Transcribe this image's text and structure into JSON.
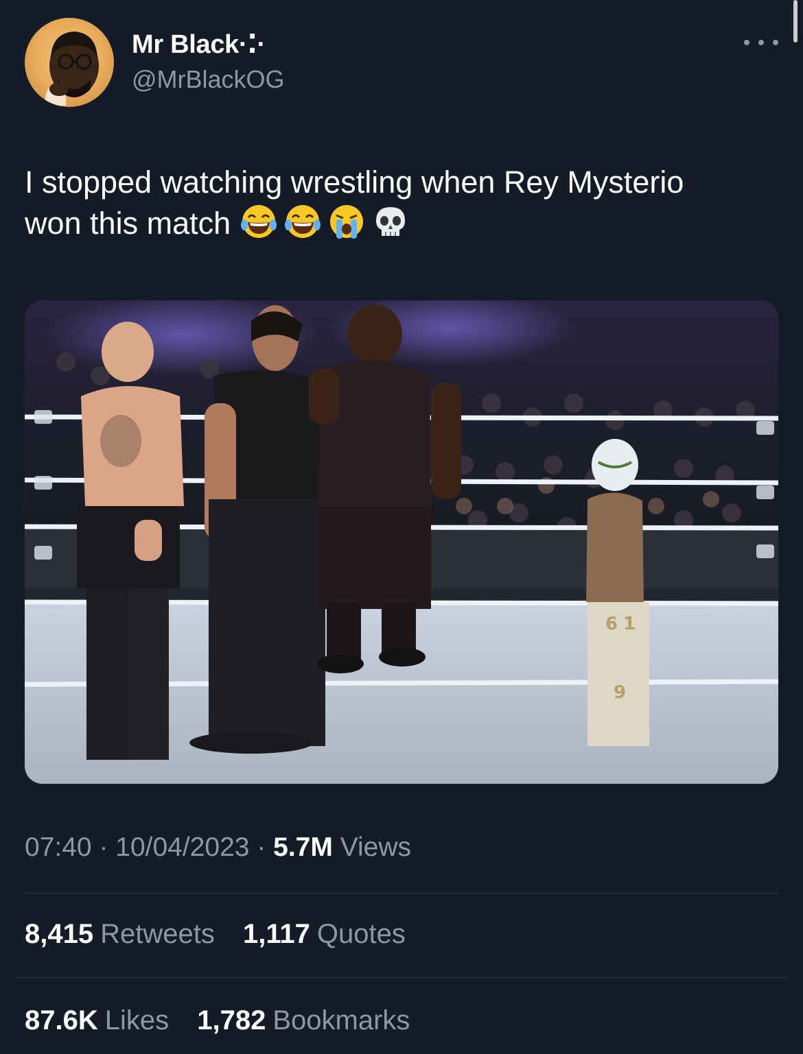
{
  "author": {
    "display_name": "Mr Black·⁚·",
    "handle": "@MrBlackOG"
  },
  "tweet": {
    "text": "I stopped watching wrestling when Rey Mysterio",
    "text_line2": "won this match",
    "emojis": [
      "laughing-tears-emoji",
      "laughing-tears-emoji",
      "loudly-crying-emoji",
      "skull-emoji"
    ]
  },
  "meta": {
    "time": "07:40",
    "sep1": " · ",
    "date": "10/04/2023",
    "sep2": " · ",
    "views_count": "5.7M",
    "views_label": " Views"
  },
  "engagement": {
    "retweets_count": "8,415",
    "retweets_label": "Retweets",
    "quotes_count": "1,117",
    "quotes_label": "Quotes",
    "likes_count": "87.6K",
    "likes_label": "Likes",
    "bookmarks_count": "1,782",
    "bookmarks_label": "Bookmarks"
  },
  "colors": {
    "background": "#151c27",
    "secondary_text": "#8b98a5",
    "divider": "#2f3a47"
  }
}
